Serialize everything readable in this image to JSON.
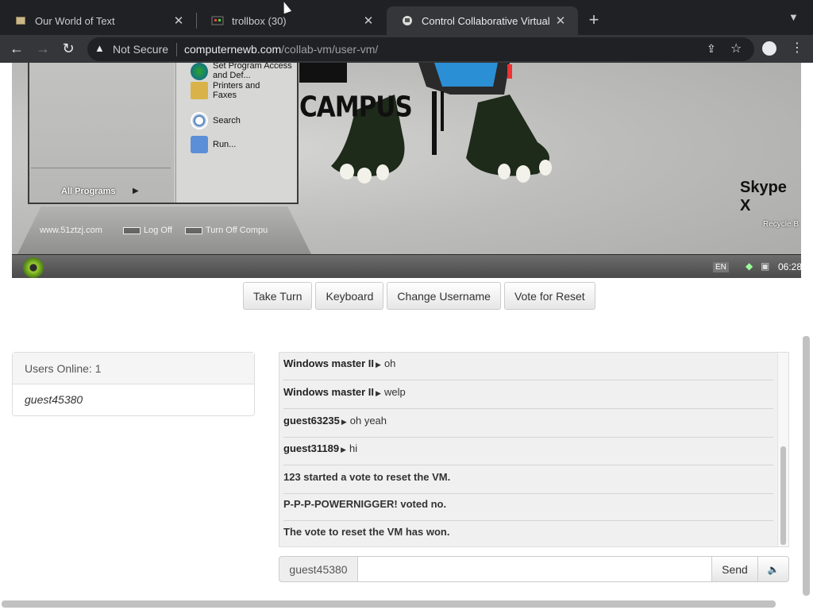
{
  "browser": {
    "tabs": [
      {
        "title": "Our World of Text",
        "icon": "book-favicon"
      },
      {
        "title": "trollbox (30)",
        "icon": "trollbox-favicon"
      },
      {
        "title": "Control Collaborative Virtual M",
        "icon": "vm-favicon"
      }
    ],
    "close_glyph": "✕",
    "new_tab_glyph": "+",
    "address": {
      "security_label": "Not Secure",
      "domain": "computernewb.com",
      "path": "/collab-vm/user-vm/"
    }
  },
  "vm": {
    "start_menu": {
      "items": [
        {
          "label": "Set Program Access and Def..."
        },
        {
          "label": "Printers and Faxes"
        },
        {
          "label": "Search"
        },
        {
          "label": "Run..."
        }
      ],
      "all_programs": "All Programs",
      "site": "www.51ztzj.com",
      "log_off": "Log Off",
      "turn_off": "Turn Off Compu"
    },
    "art_text": "CAMPUS",
    "desktop_icons": {
      "skype": "Skype X",
      "recycle": "Recycle B"
    },
    "taskbar": {
      "lang": "EN",
      "clock": "06:28"
    }
  },
  "controls": {
    "take_turn": "Take Turn",
    "keyboard": "Keyboard",
    "change_username": "Change Username",
    "vote_reset": "Vote for Reset"
  },
  "users": {
    "header": "Users Online: 1",
    "list": [
      "guest45380"
    ]
  },
  "chat": {
    "messages": [
      {
        "user": "Windows master II",
        "text": "oh"
      },
      {
        "user": "Windows master II",
        "text": "welp"
      },
      {
        "user": "guest63235",
        "text": "oh yeah"
      },
      {
        "user": "guest31189",
        "text": "hi"
      }
    ],
    "system": [
      "123 started a vote to reset the VM.",
      "P-P-P-POWERNIGGER! voted no.",
      "The vote to reset the VM has won."
    ],
    "username": "guest45380",
    "input_value": "",
    "send_label": "Send",
    "volume_glyph": "🔈"
  }
}
